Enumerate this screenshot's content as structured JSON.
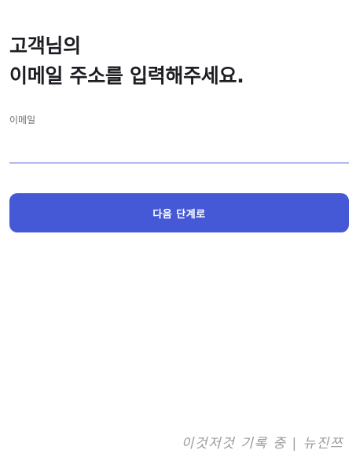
{
  "heading": {
    "line1": "고객님의",
    "line2": "이메일 주소를 입력해주세요."
  },
  "email": {
    "label": "이메일",
    "value": "",
    "placeholder": ""
  },
  "next_button": {
    "label": "다음 단계로"
  },
  "watermark": {
    "text": "이것저것 기록 중 | 뉴진쯔"
  },
  "colors": {
    "accent": "#4559d6",
    "underline": "#4a5ad9",
    "heading_text": "#1c1c22",
    "watermark_text": "#9a9aa0"
  }
}
